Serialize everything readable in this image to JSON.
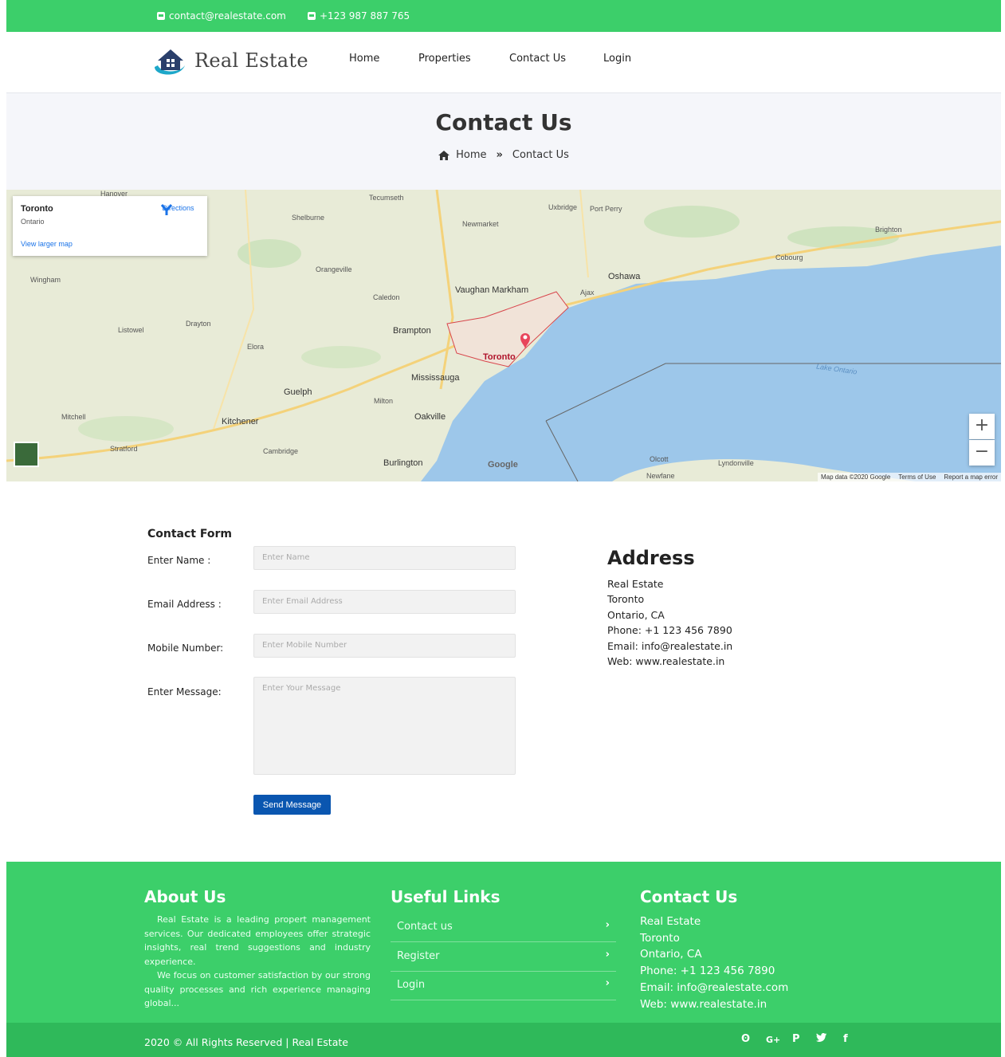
{
  "topbar": {
    "email": "contact@realestate.com",
    "phone": "+123 987 887 765"
  },
  "header": {
    "brand": "Real Estate",
    "nav": [
      "Home",
      "Properties",
      "Contact Us",
      "Login"
    ]
  },
  "page": {
    "title": "Contact Us",
    "breadcrumb": [
      "Home",
      "Contact Us"
    ]
  },
  "map": {
    "info_title": "Toronto",
    "info_subtitle": "Ontario",
    "directions": "Directions",
    "larger_map": "View larger map",
    "zoom_in": "+",
    "zoom_out": "−",
    "attribution": "Map data ©2020 Google",
    "terms": "Terms of Use",
    "report": "Report a map error",
    "google": "Google",
    "labels": {
      "toronto": "Toronto",
      "mississauga": "Mississauga",
      "brampton": "Brampton",
      "vaughan": "Vaughan Markham",
      "oshawa": "Oshawa",
      "oakville": "Oakville",
      "burlington": "Burlington",
      "guelph": "Guelph",
      "kitchener": "Kitchener",
      "cambridge": "Cambridge",
      "newmarket": "Newmarket",
      "lake": "Lake Ontario",
      "hanover": "Hanover",
      "shelburne": "Shelburne",
      "tecumseth": "Tecumseth",
      "uxbridge": "Uxbridge",
      "port_perry": "Port Perry",
      "orangeville": "Orangeville",
      "caledon": "Caledon",
      "milton": "Milton",
      "ajax": "Ajax",
      "cobourg": "Cobourg",
      "brighton": "Brighton",
      "wingham": "Wingham",
      "listowel": "Listowel",
      "stratford": "Stratford",
      "newfane": "Newfane",
      "olcott": "Olcott",
      "lyndonville": "Lyndonville",
      "mitchell": "Mitchell",
      "elora": "Elora",
      "drayton": "Drayton"
    }
  },
  "form": {
    "title": "Contact Form",
    "name_label": "Enter Name :",
    "name_placeholder": "Enter Name",
    "email_label": "Email Address :",
    "email_placeholder": "Enter Email Address",
    "mobile_label": "Mobile Number:",
    "mobile_placeholder": "Enter Mobile Number",
    "message_label": "Enter Message:",
    "message_placeholder": "Enter Your Message",
    "submit": "Send Message"
  },
  "address": {
    "title": "Address",
    "lines": [
      "Real Estate",
      "Toronto",
      "Ontario, CA",
      "Phone: +1 123 456 7890",
      "Email: info@realestate.in",
      "Web: www.realestate.in"
    ]
  },
  "footer": {
    "about_title": "About Us",
    "about_p1": "Real Estate is a leading propert management services. Our dedicated employees offer strategic insights, real trend suggestions and industry experience.",
    "about_p2": "We focus on customer satisfaction by our strong quality processes and rich experience managing global...",
    "links_title": "Useful Links",
    "links": [
      "Contact us",
      "Register",
      "Login"
    ],
    "contact_title": "Contact Us",
    "contact_lines": [
      "Real Estate",
      "Toronto",
      "Ontario, CA",
      "Phone: +1 123 456 7890",
      "Email: info@realestate.com",
      "Web: www.realestate.in"
    ],
    "copyright": "2020 © All Rights Reserved | Real Estate",
    "social_icons": [
      "github-icon",
      "google-plus-icon",
      "pinterest-icon",
      "twitter-icon",
      "facebook-icon"
    ],
    "social_glyphs": [
      "ʘ",
      "G+",
      "P",
      "🐦",
      "f"
    ]
  },
  "colors": {
    "green": "#3ccf6a",
    "green_dark": "#2fb95a",
    "button_blue": "#0a56b0",
    "water": "#9dc7ea"
  }
}
